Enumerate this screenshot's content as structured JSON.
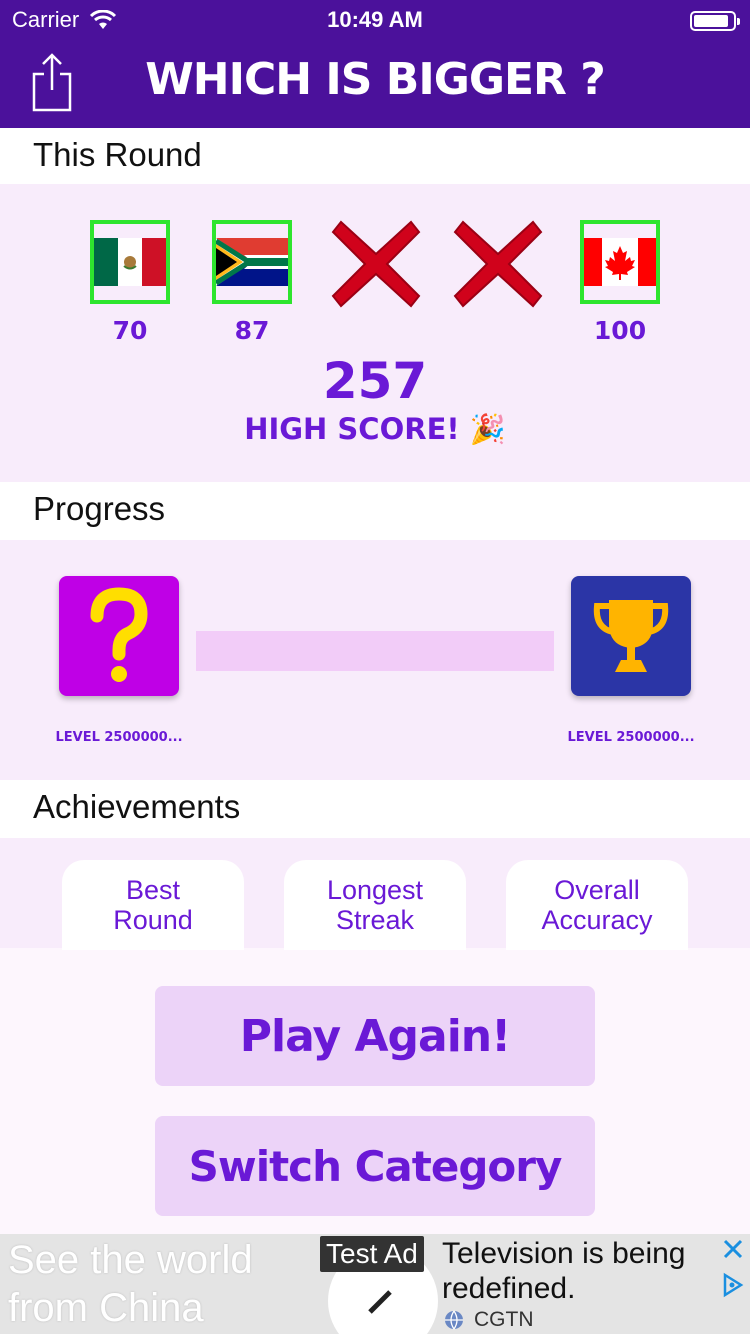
{
  "status_bar": {
    "carrier": "Carrier",
    "time": "10:49 AM"
  },
  "nav": {
    "title": "WHICH IS BIGGER ?",
    "share_icon": "share-icon"
  },
  "this_round": {
    "header": "This Round",
    "slots": [
      {
        "type": "flag",
        "country": "mexico",
        "score": "70"
      },
      {
        "type": "flag",
        "country": "south-africa",
        "score": "87"
      },
      {
        "type": "miss",
        "score": ""
      },
      {
        "type": "miss",
        "score": ""
      },
      {
        "type": "flag",
        "country": "canada",
        "score": "100"
      }
    ],
    "total": "257",
    "badge": "HIGH SCORE! 🎉"
  },
  "progress": {
    "header": "Progress",
    "current_level": "LEVEL 2500000...",
    "next_level": "LEVEL 2500000...",
    "fill_fraction": 0.0,
    "current_icon": "question-mark-icon",
    "next_icon": "trophy-icon"
  },
  "achievements": {
    "header": "Achievements",
    "cards": [
      {
        "line1": "Best",
        "line2": "Round"
      },
      {
        "line1": "Longest",
        "line2": "Streak"
      },
      {
        "line1": "Overall",
        "line2": "Accuracy"
      }
    ]
  },
  "buttons": {
    "play_again": "Play Again!",
    "switch_category": "Switch Category"
  },
  "ad": {
    "image_text_line1": "See the world",
    "image_text_line2": "from China",
    "tag": "Test Ad",
    "headline": "Television is being redefined.",
    "source": "CGTN"
  },
  "colors": {
    "nav_bg": "#4b119b",
    "accent": "#6a19d6",
    "panel_bg": "#f8ecfb",
    "button_bg": "#ecd3f8",
    "correct_border": "#2ee52e"
  }
}
